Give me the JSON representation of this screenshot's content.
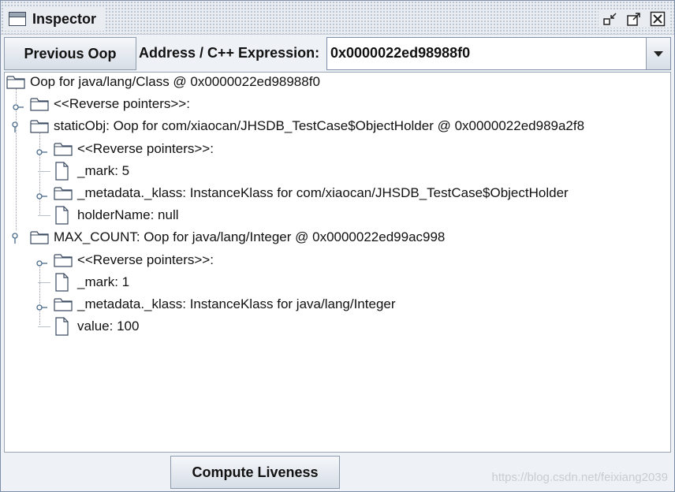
{
  "window": {
    "title": "Inspector"
  },
  "toolbar": {
    "prev_button": "Previous Oop",
    "address_label": "Address / C++ Expression:",
    "address_value": "0x0000022ed98988f0"
  },
  "tree": {
    "nodes": [
      {
        "label": "Oop for java/lang/Class @ 0x0000022ed98988f0",
        "type": "folder",
        "depth": 0
      },
      {
        "label": "<<Reverse pointers>>:",
        "type": "folder",
        "depth": 1,
        "expanded": false
      },
      {
        "label": "staticObj: Oop for com/xiaocan/JHSDB_TestCase$ObjectHolder @ 0x0000022ed989a2f8",
        "type": "folder",
        "depth": 1,
        "expanded": true
      },
      {
        "label": "<<Reverse pointers>>:",
        "type": "folder",
        "depth": 2,
        "expanded": false
      },
      {
        "label": "_mark: 5",
        "type": "file",
        "depth": 2
      },
      {
        "label": "_metadata._klass: InstanceKlass for com/xiaocan/JHSDB_TestCase$ObjectHolder",
        "type": "folder",
        "depth": 2,
        "expanded": false
      },
      {
        "label": "holderName: null",
        "type": "file",
        "depth": 2
      },
      {
        "label": "MAX_COUNT: Oop for java/lang/Integer @ 0x0000022ed99ac998",
        "type": "folder",
        "depth": 1,
        "expanded": true
      },
      {
        "label": "<<Reverse pointers>>:",
        "type": "folder",
        "depth": 2,
        "expanded": false
      },
      {
        "label": "_mark: 1",
        "type": "file",
        "depth": 2
      },
      {
        "label": "_metadata._klass: InstanceKlass for java/lang/Integer",
        "type": "folder",
        "depth": 2,
        "expanded": false
      },
      {
        "label": "value: 100",
        "type": "file",
        "depth": 2
      }
    ]
  },
  "bottom": {
    "liveness_button": "Compute Liveness",
    "watermark": "https://blog.csdn.net/feixiang2039"
  }
}
